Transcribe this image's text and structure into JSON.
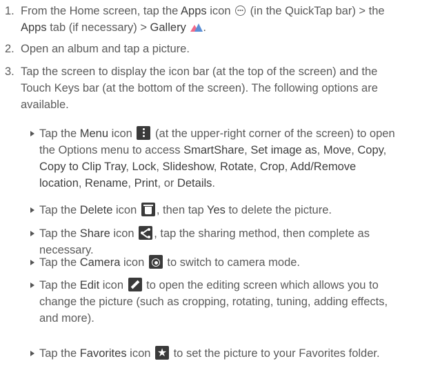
{
  "steps": [
    {
      "n": "1.",
      "segs": [
        "From the Home screen, tap the ",
        "Apps",
        " icon ",
        " (in the QuickTap bar) > the ",
        "Apps",
        " tab (if necessary) > ",
        "Gallery",
        "."
      ]
    },
    {
      "n": "2.",
      "text": "Open an album and tap a picture."
    },
    {
      "n": "3.",
      "lines": [
        "Tap the screen to display the icon bar (at the top of the screen) and the",
        "Touch Keys bar (at the bottom of the screen). The following options are",
        "available."
      ]
    }
  ],
  "bullets": {
    "menu": {
      "t1": "Tap the ",
      "name": "Menu",
      "t2": " icon ",
      "t3": " (at the upper-right corner of the screen) to open",
      "t4": "the Options menu to access ",
      "o1": "SmartShare",
      "o2": "Set image as",
      "o3": "Move",
      "o4": "Copy",
      "o5": "Copy to Clip Tray",
      "o6": "Lock",
      "o7": "Slideshow",
      "o8": "Rotate",
      "o9": "Crop",
      "o10": "Add/Remove",
      "o11": "location",
      "o12": "Rename",
      "o13": "Print",
      "o14": "Details",
      "sep": ", ",
      "or": ", or ",
      "end": "."
    },
    "delete": {
      "t1": "Tap the ",
      "name": "Delete",
      "t2": " icon ",
      "t3": ", then tap ",
      "yes": "Yes",
      "t4": " to delete the picture."
    },
    "share": {
      "t1": "Tap the ",
      "name": "Share",
      "t2": " icon ",
      "t3": ", tap the sharing method, then complete as",
      "t4": "necessary."
    },
    "camera": {
      "t1": "Tap the ",
      "name": "Camera",
      "t2": " icon ",
      "t3": " to switch to camera mode."
    },
    "edit": {
      "t1": "Tap the ",
      "name": "Edit",
      "t2": " icon ",
      "t3": " to open the editing screen which allows you to",
      "t4": "change the picture (such as cropping, rotating, tuning, adding effects,",
      "t5": "and more)."
    },
    "favorites": {
      "t1": "Tap the ",
      "name": "Favorites",
      "t2": " icon ",
      "t3": " to set the picture to your Favorites folder."
    }
  },
  "icons": [
    "apps-icon",
    "gallery-icon",
    "menu-icon",
    "delete-icon",
    "share-icon",
    "camera-icon",
    "edit-icon",
    "favorites-icon"
  ],
  "colors": {
    "text": "#5a5a5a",
    "emphasis": "#3d3d3d",
    "icon_bg": "#3a3a3a",
    "gallery_pink": "#f06a8a",
    "gallery_blue": "#5b8fd6"
  }
}
